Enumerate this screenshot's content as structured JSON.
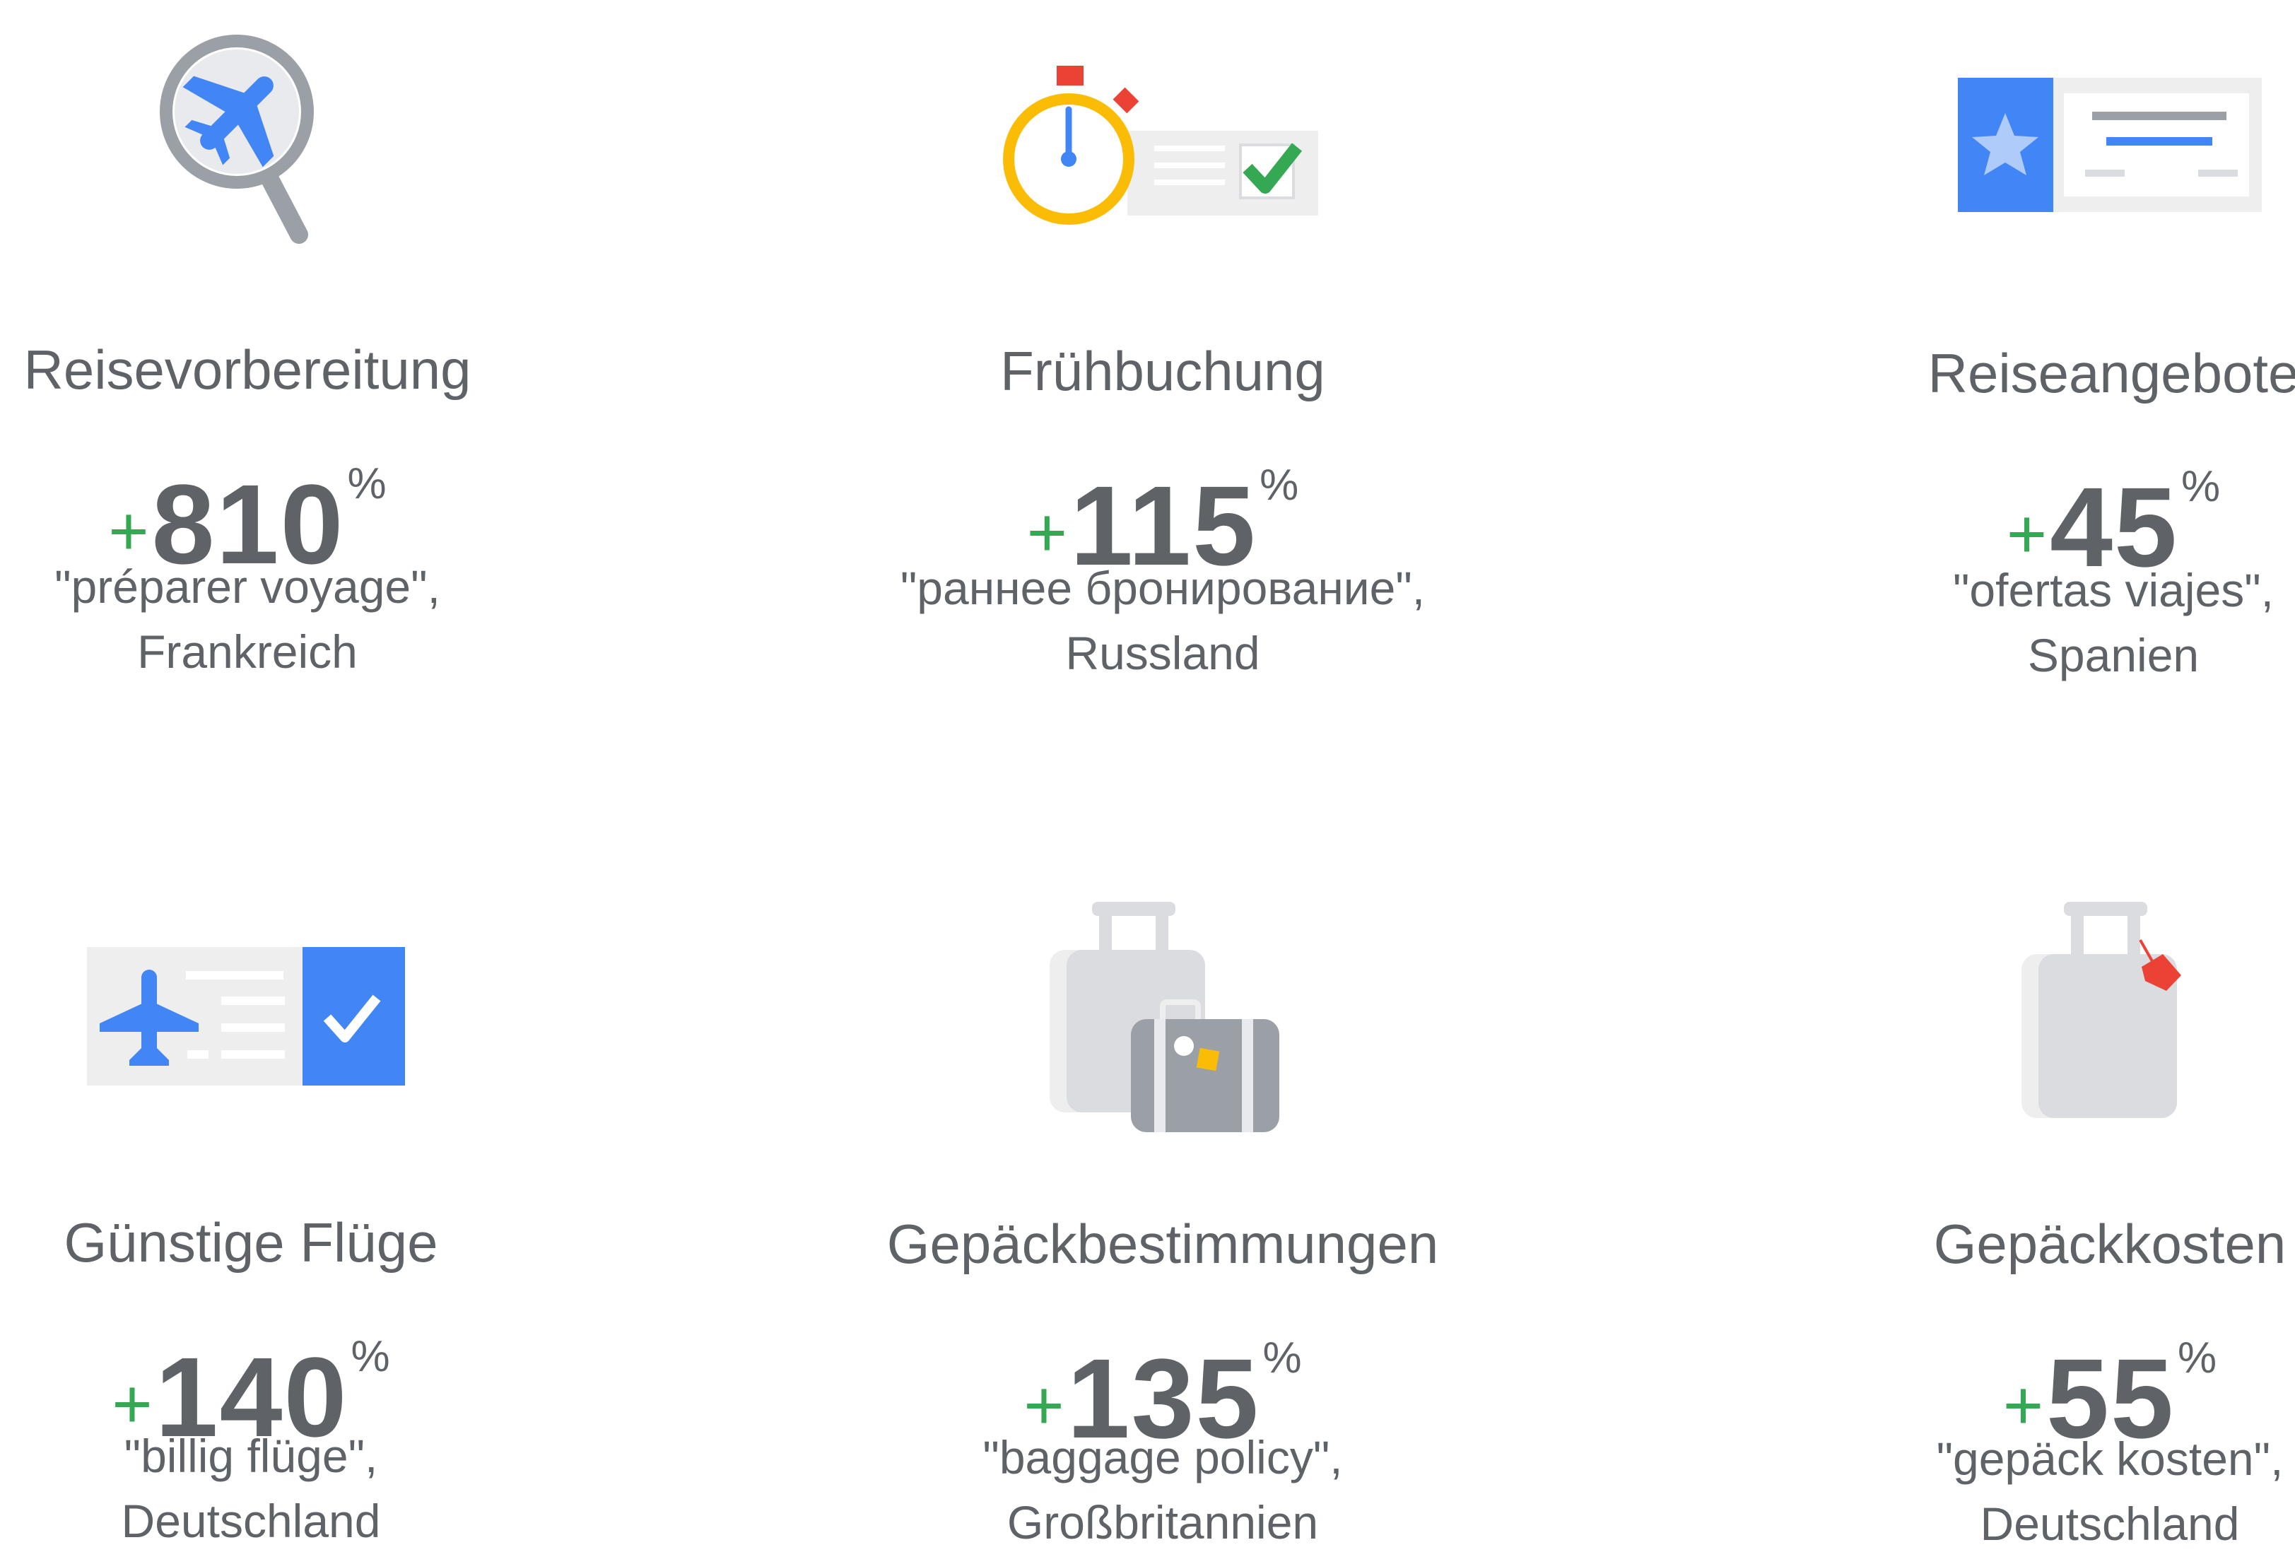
{
  "cards": [
    {
      "title": "Reisevorbereitung",
      "plus": "+",
      "value": "810",
      "unit": "%",
      "query": "\"préparer voyage\",",
      "country": "Frankreich",
      "icon": "plane-search-icon"
    },
    {
      "title": "Frühbuchung",
      "plus": "+",
      "value": "115",
      "unit": "%",
      "query": "\"раннее бронирование\",",
      "country": "Russland",
      "icon": "stopwatch-checklist-icon"
    },
    {
      "title": "Reiseangebote",
      "plus": "+",
      "value": "45",
      "unit": "%",
      "query": "\"ofertas viajes\",",
      "country": "Spanien",
      "icon": "star-ticket-icon"
    },
    {
      "title": "Günstige Flüge",
      "plus": "+",
      "value": "140",
      "unit": "%",
      "query": "\"billig flüge\",",
      "country": "Deutschland",
      "icon": "plane-ticket-check-icon"
    },
    {
      "title": "Gepäckbestimmungen",
      "plus": "+",
      "value": "135",
      "unit": "%",
      "query": "\"baggage policy\",",
      "country": "Großbritannien",
      "icon": "luggage-pair-icon"
    },
    {
      "title": "Gepäckkosten",
      "plus": "+",
      "value": "55",
      "unit": "%",
      "query": "\"gepäck kosten\",",
      "country": "Deutschland",
      "icon": "suitcase-tag-icon"
    }
  ],
  "colors": {
    "green": "#34a853",
    "blue": "#4285f4",
    "yellow": "#fbbc05",
    "red": "#ea4335",
    "grey_text": "#5f6368",
    "light_grey": "#dadce0"
  }
}
